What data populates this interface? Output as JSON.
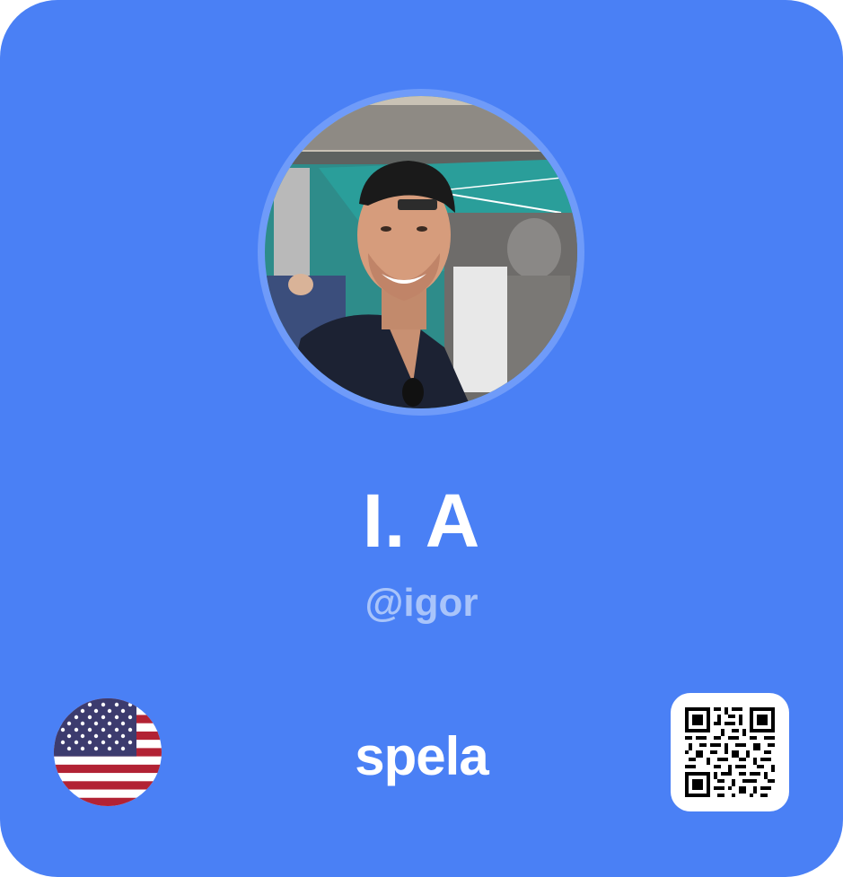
{
  "profile": {
    "name": "I. A",
    "handle": "@igor",
    "country_flag": "us-flag-icon"
  },
  "brand": {
    "label": "spela"
  },
  "colors": {
    "card_background": "#4A80F5",
    "handle_text": "#A9C4FA",
    "primary_text": "#FFFFFF"
  },
  "qr_code": {
    "icon": "qr-code-icon"
  }
}
